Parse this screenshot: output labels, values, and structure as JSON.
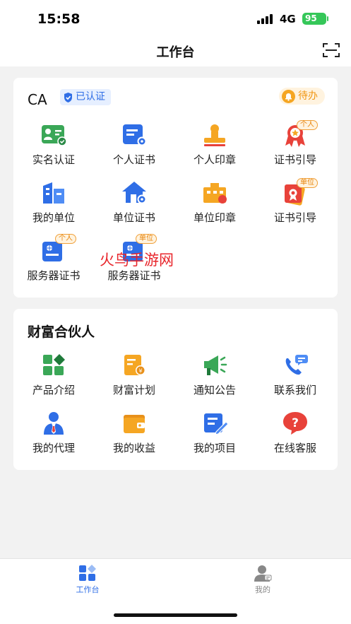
{
  "status_bar": {
    "time": "15:58",
    "network": "4G",
    "battery": "95"
  },
  "nav": {
    "title": "工作台"
  },
  "ca": {
    "title": "CA",
    "verified_label": "已认证",
    "todo_label": "待办",
    "items": [
      {
        "label": "实名认证",
        "icon": "id-card-icon"
      },
      {
        "label": "个人证书",
        "icon": "certificate-icon"
      },
      {
        "label": "个人印章",
        "icon": "stamp-icon"
      },
      {
        "label": "证书引导",
        "icon": "award-icon",
        "tag": "个人"
      },
      {
        "label": "我的单位",
        "icon": "building-icon"
      },
      {
        "label": "单位证书",
        "icon": "house-cert-icon"
      },
      {
        "label": "单位印章",
        "icon": "unit-stamp-icon"
      },
      {
        "label": "证书引导",
        "icon": "award-icon",
        "tag": "单位"
      },
      {
        "label": "服务器证书",
        "icon": "server-cert-icon",
        "tag": "个人"
      },
      {
        "label": "服务器证书",
        "icon": "server-cert-icon",
        "tag": "单位"
      }
    ]
  },
  "partner": {
    "title": "财富合伙人",
    "items": [
      {
        "label": "产品介绍",
        "icon": "product-grid-icon"
      },
      {
        "label": "财富计划",
        "icon": "wealth-plan-icon"
      },
      {
        "label": "通知公告",
        "icon": "megaphone-icon"
      },
      {
        "label": "联系我们",
        "icon": "phone-chat-icon"
      },
      {
        "label": "我的代理",
        "icon": "agent-person-icon"
      },
      {
        "label": "我的收益",
        "icon": "wallet-icon"
      },
      {
        "label": "我的项目",
        "icon": "project-edit-icon"
      },
      {
        "label": "在线客服",
        "icon": "help-chat-icon"
      }
    ]
  },
  "watermark": "火鸟手游网",
  "tabs": {
    "work": "工作台",
    "mine": "我的"
  },
  "colors": {
    "blue": "#2f6ee6",
    "orange": "#f5a623",
    "red": "#e8423a",
    "green": "#3aa757"
  }
}
